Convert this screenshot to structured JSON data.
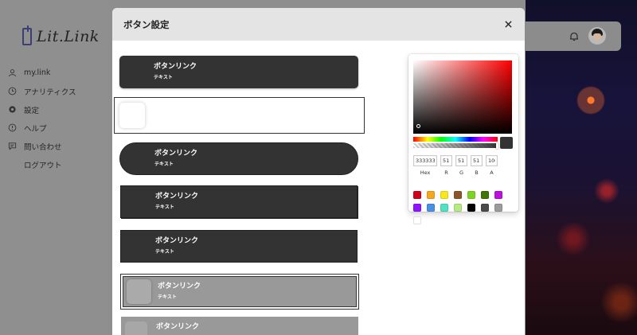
{
  "app": {
    "logo_text": "Lit.Link"
  },
  "sidebar": {
    "items": [
      {
        "label": "my.link",
        "icon": "user-icon"
      },
      {
        "label": "アナリティクス",
        "icon": "clock-icon"
      },
      {
        "label": "設定",
        "icon": "gear-icon"
      },
      {
        "label": "ヘルプ",
        "icon": "help-icon"
      },
      {
        "label": "問い合わせ",
        "icon": "message-icon"
      },
      {
        "label": "ログアウト",
        "icon": ""
      }
    ]
  },
  "header": {
    "bell_icon": "bell-icon",
    "avatar": "avatar"
  },
  "modal": {
    "title": "ボタン設定",
    "close_icon": "close-icon",
    "options": [
      {
        "title": "ボタンリンク",
        "subtitle": "テキスト"
      },
      {
        "title": "",
        "subtitle": ""
      },
      {
        "title": "ボタンリンク",
        "subtitle": "テキスト"
      },
      {
        "title": "ボタンリンク",
        "subtitle": "テキスト"
      },
      {
        "title": "ボタンリンク",
        "subtitle": "テキスト"
      },
      {
        "title": "ボタンリンク",
        "subtitle": "テキスト"
      },
      {
        "title": "ボタンリンク",
        "subtitle": ""
      }
    ]
  },
  "color_picker": {
    "current_color": "#333333",
    "fields": [
      {
        "label": "Hex",
        "value": "333333"
      },
      {
        "label": "R",
        "value": "51"
      },
      {
        "label": "G",
        "value": "51"
      },
      {
        "label": "B",
        "value": "51"
      },
      {
        "label": "A",
        "value": "100"
      }
    ],
    "presets": [
      "#d0021b",
      "#f5a623",
      "#f8e71c",
      "#8b572a",
      "#7ed321",
      "#417505",
      "#bd10e0",
      "#9013fe",
      "#4a90e2",
      "#50e3c2",
      "#b8e986",
      "#000000",
      "#4a4a4a",
      "#9b9b9b",
      "#ffffff"
    ]
  }
}
